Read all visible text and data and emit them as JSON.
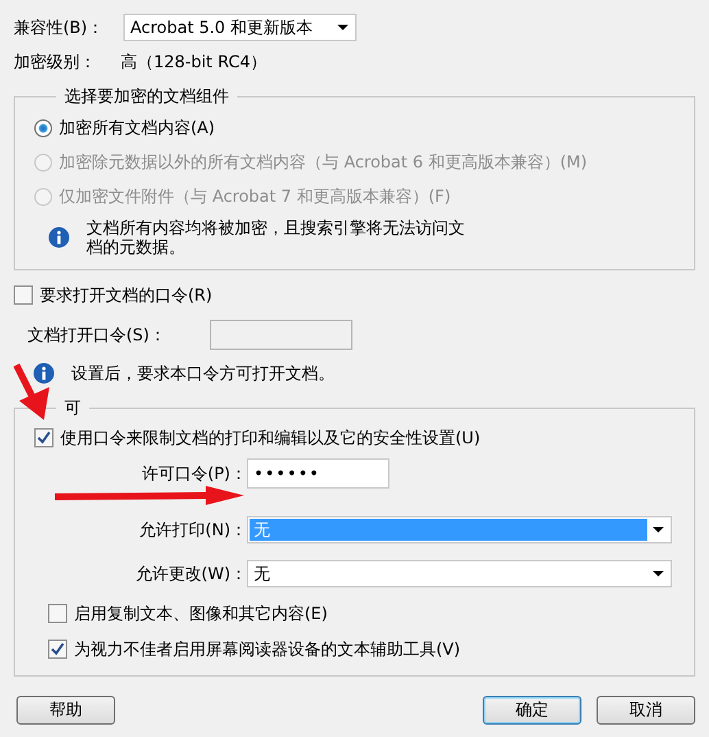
{
  "compatibility": {
    "label": "兼容性(B)：",
    "value": "Acrobat 5.0 和更新版本"
  },
  "encryption_level": {
    "label": "加密级别：",
    "value": "高（128-bit RC4）"
  },
  "components": {
    "title": "选择要加密的文档组件",
    "options": [
      {
        "label": "加密所有文档内容(A)",
        "selected": true,
        "disabled": false
      },
      {
        "label": "加密除元数据以外的所有文档内容（与 Acrobat 6 和更高版本兼容）(M)",
        "selected": false,
        "disabled": true
      },
      {
        "label": "仅加密文件附件（与 Acrobat 7 和更高版本兼容）(F)",
        "selected": false,
        "disabled": true
      }
    ],
    "info": "文档所有内容均将被加密，且搜索引擎将无法访问文档的元数据。"
  },
  "require_open_password": {
    "label": "要求打开文档的口令(R)",
    "checked": false
  },
  "open_password": {
    "label": "文档打开口令(S)：",
    "disabled": true
  },
  "open_info": "设置后，要求本口令方可打开文档。",
  "permissions": {
    "title": "可",
    "restrict": {
      "label": "使用口令来限制文档的打印和编辑以及它的安全性设置(U)",
      "checked": true
    },
    "password": {
      "label": "许可口令(P)：",
      "value": "••••••"
    },
    "selects": [
      {
        "label": "允许打印(N)：",
        "value": "无",
        "focused": true
      },
      {
        "label": "允许更改(W)：",
        "value": "无",
        "focused": false
      }
    ],
    "options": [
      {
        "label": "启用复制文本、图像和其它内容(E)",
        "checked": false
      },
      {
        "label": "为视力不佳者启用屏幕阅读器设备的文本辅助工具(V)",
        "checked": true
      }
    ]
  },
  "buttons": [
    {
      "label": "帮助",
      "default": false
    },
    {
      "label": "确定",
      "default": true
    },
    {
      "label": "取消",
      "default": false
    }
  ]
}
